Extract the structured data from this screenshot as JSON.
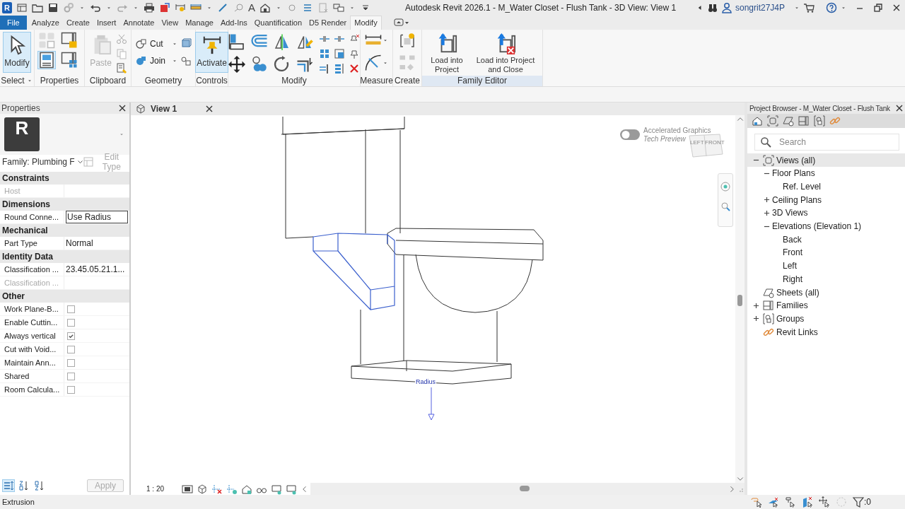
{
  "window": {
    "logo": "R",
    "text_tool": "A",
    "title": "Autodesk Revit 2026.1 - M_Water Closet - Flush Tank - 3D View: View 1",
    "user": "songrit27J4P"
  },
  "ribbon": {
    "tabs": [
      {
        "label": "File",
        "kind": "file",
        "selected": false
      },
      {
        "label": "Analyze",
        "kind": "tab",
        "selected": false
      },
      {
        "label": "Create",
        "kind": "tab",
        "selected": false
      },
      {
        "label": "Insert",
        "kind": "tab",
        "selected": false
      },
      {
        "label": "Annotate",
        "kind": "tab",
        "selected": false
      },
      {
        "label": "View",
        "kind": "tab",
        "selected": false
      },
      {
        "label": "Manage",
        "kind": "tab",
        "selected": false
      },
      {
        "label": "Add-Ins",
        "kind": "tab",
        "selected": false
      },
      {
        "label": "Quantification",
        "kind": "tab",
        "selected": false
      },
      {
        "label": "D5 Render",
        "kind": "tab",
        "selected": false
      },
      {
        "label": "Modify",
        "kind": "tab",
        "selected": true
      }
    ],
    "panels": [
      {
        "kind": "select",
        "label": "Select",
        "highlighted": false,
        "tools": [
          {
            "label": "Modify",
            "active": true,
            "disabled": false
          }
        ]
      },
      {
        "kind": "properties",
        "label": "Properties",
        "highlighted": false
      },
      {
        "kind": "clipboard",
        "label": "Clipboard",
        "highlighted": false,
        "tools": [
          {
            "label": "Paste",
            "active": false,
            "disabled": true
          }
        ]
      },
      {
        "kind": "geometry",
        "label": "Geometry",
        "highlighted": false,
        "tools": [
          {
            "label": "Cut",
            "active": false,
            "disabled": false
          },
          {
            "label": "Join",
            "active": false,
            "disabled": false
          }
        ]
      },
      {
        "kind": "controls",
        "label": "Controls",
        "highlighted": false,
        "tools": [
          {
            "label": "Activate",
            "active": true,
            "disabled": false
          }
        ]
      },
      {
        "kind": "modify",
        "label": "Modify",
        "highlighted": false
      },
      {
        "kind": "measure",
        "label": "Measure",
        "highlighted": false
      },
      {
        "kind": "create",
        "label": "Create",
        "highlighted": false
      },
      {
        "kind": "family_editor",
        "label": "Family Editor",
        "highlighted": true,
        "tools": [
          {
            "label": "Load into Project",
            "active": false,
            "disabled": false
          },
          {
            "label": "Load into Project and Close",
            "active": false,
            "disabled": false
          }
        ]
      }
    ]
  },
  "properties": {
    "title": "Properties",
    "type_letter": "R",
    "type_selector": "Family: Plumbing F",
    "edit_type": {
      "label": "Edit Type",
      "disabled": true
    },
    "groups": [
      {
        "name": "Constraints",
        "rows": [
          {
            "label": "Host",
            "kind": "text",
            "disabled": true
          }
        ]
      },
      {
        "name": "Dimensions",
        "rows": [
          {
            "label": "Round Conne...",
            "kind": "edit",
            "value": "Use Radius",
            "disabled": false
          }
        ]
      },
      {
        "name": "Mechanical",
        "rows": [
          {
            "label": "Part Type",
            "kind": "text",
            "value": "Normal",
            "disabled": false
          }
        ]
      },
      {
        "name": "Identity Data",
        "rows": [
          {
            "label": "Classification ...",
            "kind": "text",
            "value": "23.45.05.21.1...",
            "disabled": false
          },
          {
            "label": "Classification ...",
            "kind": "text",
            "disabled": true
          }
        ]
      },
      {
        "name": "Other",
        "rows": [
          {
            "label": "Work Plane-B...",
            "kind": "check",
            "checked": false,
            "disabled": false
          },
          {
            "label": "Enable Cuttin...",
            "kind": "check",
            "checked": false,
            "disabled": false
          },
          {
            "label": "Always vertical",
            "kind": "check",
            "checked": true,
            "disabled": false
          },
          {
            "label": "Cut with Void...",
            "kind": "check",
            "checked": false,
            "disabled": false
          },
          {
            "label": "Maintain Ann...",
            "kind": "check",
            "checked": false,
            "disabled": false
          },
          {
            "label": "Shared",
            "kind": "check",
            "checked": false,
            "disabled": false
          },
          {
            "label": "Room Calcula...",
            "kind": "check",
            "checked": false,
            "disabled": false
          }
        ]
      }
    ],
    "apply": {
      "label": "Apply",
      "disabled": true
    }
  },
  "view": {
    "tab": {
      "label": "View 1",
      "selected": true
    },
    "scale": "1 : 20"
  },
  "canvas": {
    "graphics_toggle": {
      "label": "Accelerated Graphics",
      "note": "Tech Preview",
      "on": false
    },
    "view_cube": {
      "left": "LEFT",
      "front": "FRONT"
    },
    "dimension_label": "Radius"
  },
  "project_browser": {
    "title": "Project Browser - M_Water Closet - Flush Tank",
    "search_placeholder": "Search",
    "tree": [
      {
        "label": "Views (all)",
        "kind": "views",
        "expanded": true,
        "selected": true,
        "children": [
          {
            "label": "Floor Plans",
            "expanded": true,
            "selected": false,
            "children": [
              {
                "label": "Ref. Level",
                "selected": false
              }
            ]
          },
          {
            "label": "Ceiling Plans",
            "expanded": false,
            "selected": false
          },
          {
            "label": "3D Views",
            "expanded": false,
            "selected": false
          },
          {
            "label": "Elevations (Elevation 1)",
            "expanded": true,
            "selected": false,
            "children": [
              {
                "label": "Back",
                "selected": false
              },
              {
                "label": "Front",
                "selected": false
              },
              {
                "label": "Left",
                "selected": false
              },
              {
                "label": "Right",
                "selected": false
              }
            ]
          }
        ]
      },
      {
        "label": "Sheets (all)",
        "kind": "sheets",
        "selected": false
      },
      {
        "label": "Families",
        "kind": "families",
        "expanded": false,
        "selected": false
      },
      {
        "label": "Groups",
        "kind": "groups",
        "expanded": false,
        "selected": false
      },
      {
        "label": "Revit Links",
        "kind": "links",
        "selected": false
      }
    ]
  },
  "status_bar": {
    "text": "Extrusion",
    "filter_count": ":0"
  }
}
